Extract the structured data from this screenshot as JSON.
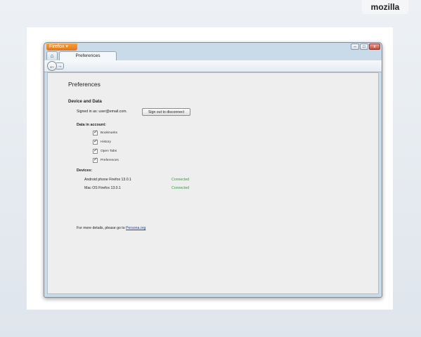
{
  "brand": "mozilla",
  "window": {
    "app_menu": "Firefox",
    "app_menu_arrow": "▾",
    "controls": {
      "minimize": "–",
      "maximize": "□",
      "close": "x"
    },
    "home_icon": "⌂",
    "tab_title": "Preferences",
    "back_icon": "←",
    "forward_icon": "→"
  },
  "page": {
    "title": "Preferences",
    "section_title": "Device and Data",
    "signed_in": "Signed in as: user@email.com.",
    "signout_button": "Sign out to disconnect",
    "data_heading": "Data in account:",
    "data_items": [
      {
        "label": "Bookmarks",
        "checked": true
      },
      {
        "label": "History",
        "checked": true
      },
      {
        "label": "Open Tabs",
        "checked": true
      },
      {
        "label": "Preferences",
        "checked": true
      }
    ],
    "check_glyph": "✓",
    "devices_heading": "Devices:",
    "devices": [
      {
        "name": "Android phone Firefox 13.0.1",
        "status": "Connected"
      },
      {
        "name": "Mac OS Firefox 13.0.1",
        "status": "Connected"
      }
    ],
    "more_text": "For more details, please go to ",
    "more_link": "Persona.org"
  },
  "colors": {
    "connected": "#3a9a3a",
    "link": "#1a3fd0",
    "app_menu": "#e8821f"
  }
}
